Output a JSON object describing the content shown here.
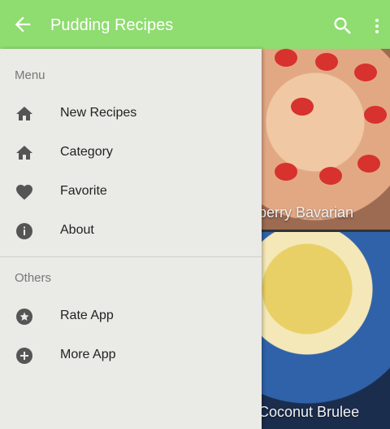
{
  "app_bar": {
    "title": "Pudding Recipes",
    "back_icon": "arrow-left-icon",
    "search_icon": "search-icon",
    "more_icon": "more-vert-icon",
    "color": "#8fdc70"
  },
  "cards": [
    {
      "caption": "berry Bavarian"
    },
    {
      "caption": "Coconut Brulee"
    }
  ],
  "drawer": {
    "menu_label": "Menu",
    "menu_items": [
      {
        "label": "New Recipes",
        "icon": "home-icon"
      },
      {
        "label": "Category",
        "icon": "home-icon"
      },
      {
        "label": "Favorite",
        "icon": "heart-icon"
      },
      {
        "label": "About",
        "icon": "info-icon"
      }
    ],
    "others_label": "Others",
    "others_items": [
      {
        "label": "Rate App",
        "icon": "star-circle-icon"
      },
      {
        "label": "More App",
        "icon": "plus-circle-icon"
      }
    ]
  }
}
